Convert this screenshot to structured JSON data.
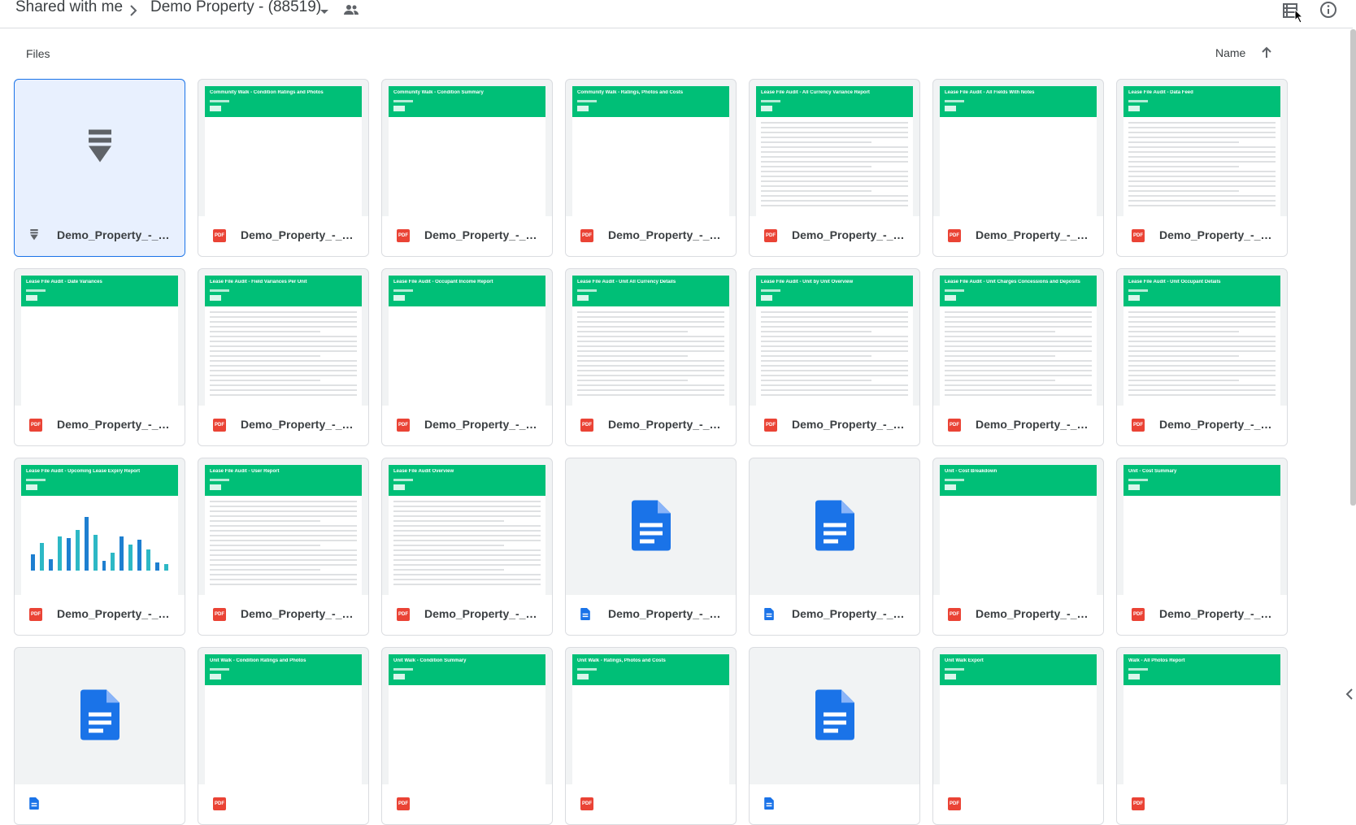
{
  "header": {
    "breadcrumb_root": "Shared with me",
    "breadcrumb_current": "Demo Property - (88519)",
    "icons": [
      "chevron-right-icon",
      "caret-down-icon",
      "shared-people-icon",
      "list-view-icon",
      "info-icon"
    ]
  },
  "files_section": {
    "label": "Files",
    "sort_label": "Name",
    "sort_direction": "ascending"
  },
  "colors": {
    "banner_green": "#00bf77",
    "pdf_red": "#ea4335",
    "doc_blue": "#1a73e8",
    "selected_bg": "#e8f0fe"
  },
  "files": [
    {
      "name": "Demo_Property_-_All_...",
      "type": "archive",
      "thumb": "icon",
      "selected": true
    },
    {
      "name": "Demo_Property_-_Co...",
      "type": "pdf",
      "thumb": "report",
      "title": "Community Walk - Condition Ratings and Photos"
    },
    {
      "name": "Demo_Property_-_Co...",
      "type": "pdf",
      "thumb": "report",
      "title": "Community Walk - Condition Summary"
    },
    {
      "name": "Demo_Property_-_Co...",
      "type": "pdf",
      "thumb": "report",
      "title": "Community Walk - Ratings, Photos and Costs"
    },
    {
      "name": "Demo_Property_-_Lea...",
      "type": "pdf",
      "thumb": "report",
      "title": "Lease File Audit - All Currency Variance Report",
      "has_table": true
    },
    {
      "name": "Demo_Property_-_Lea...",
      "type": "pdf",
      "thumb": "report",
      "title": "Lease File Audit - All Fields With Notes"
    },
    {
      "name": "Demo_Property_-_Lea...",
      "type": "pdf",
      "thumb": "report",
      "title": "Lease File Audit - Data Feed",
      "has_table": true
    },
    {
      "name": "Demo_Property_-_Lea...",
      "type": "pdf",
      "thumb": "report",
      "title": "Lease File Audit - Date Variances"
    },
    {
      "name": "Demo_Property_-_Lea...",
      "type": "pdf",
      "thumb": "report",
      "title": "Lease File Audit - Field Variances Per Unit",
      "has_table": true
    },
    {
      "name": "Demo_Property_-_Lea...",
      "type": "pdf",
      "thumb": "report",
      "title": "Lease File Audit - Occupant Income Report"
    },
    {
      "name": "Demo_Property_-_Lea...",
      "type": "pdf",
      "thumb": "report",
      "title": "Lease File Audit - Unit All Currency Details",
      "has_table": true
    },
    {
      "name": "Demo_Property_-_Lea...",
      "type": "pdf",
      "thumb": "report",
      "title": "Lease File Audit - Unit by Unit Overview",
      "has_table": true
    },
    {
      "name": "Demo_Property_-_Lea...",
      "type": "pdf",
      "thumb": "report",
      "title": "Lease File Audit - Unit Charges Concessions and Deposits",
      "has_table": true
    },
    {
      "name": "Demo_Property_-_Lea...",
      "type": "pdf",
      "thumb": "report",
      "title": "Lease File Audit - Unit Occupant Details",
      "has_table": true
    },
    {
      "name": "Demo_Property_-_Lea...",
      "type": "pdf",
      "thumb": "chart",
      "title": "Lease File Audit - Upcoming Lease Expiry Report"
    },
    {
      "name": "Demo_Property_-_Lea...",
      "type": "pdf",
      "thumb": "report",
      "title": "Lease File Audit - User Report",
      "has_table": true
    },
    {
      "name": "Demo_Property_-_Lea...",
      "type": "pdf",
      "thumb": "report",
      "title": "Lease File Audit Overview",
      "has_table": true
    },
    {
      "name": "Demo_Property_-_Pro...",
      "type": "doc",
      "thumb": "icon"
    },
    {
      "name": "Demo_Property_-_Raw...",
      "type": "doc",
      "thumb": "icon"
    },
    {
      "name": "Demo_Property_-_Unit...",
      "type": "pdf",
      "thumb": "report",
      "title": "Unit - Cost Breakdown"
    },
    {
      "name": "Demo_Property_-_Unit...",
      "type": "pdf",
      "thumb": "report",
      "title": "Unit - Cost Summary"
    },
    {
      "name": "",
      "type": "doc",
      "thumb": "icon"
    },
    {
      "name": "",
      "type": "pdf",
      "thumb": "report",
      "title": "Unit Walk - Condition Ratings and Photos"
    },
    {
      "name": "",
      "type": "pdf",
      "thumb": "report",
      "title": "Unit Walk - Condition Summary"
    },
    {
      "name": "",
      "type": "pdf",
      "thumb": "report",
      "title": "Unit Walk - Ratings, Photos and Costs"
    },
    {
      "name": "",
      "type": "doc",
      "thumb": "icon"
    },
    {
      "name": "",
      "type": "pdf",
      "thumb": "report",
      "title": "Unit Walk Export"
    },
    {
      "name": "",
      "type": "pdf",
      "thumb": "report",
      "title": "Walk - All Photos Report"
    }
  ]
}
